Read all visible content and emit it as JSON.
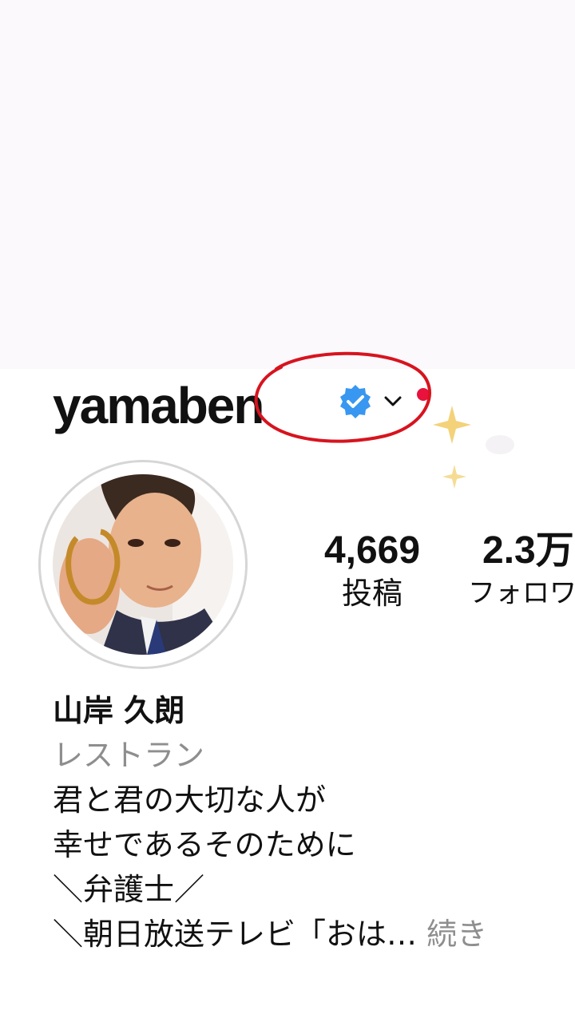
{
  "profile": {
    "username": "yamaben",
    "verified": true,
    "avatar_icon": "profile-photo"
  },
  "stats": [
    {
      "value": "4,669",
      "label": "投稿"
    },
    {
      "value": "2.3万",
      "label": "フォロワー"
    }
  ],
  "bio": {
    "name": "山岸 久朗",
    "category": "レストラン",
    "lines": [
      "君と君の大切な人が",
      "幸せであるそのために",
      "＼弁護士／"
    ],
    "truncated_line": "＼朝日放送テレビ「おは…",
    "more_label": "続き"
  },
  "colors": {
    "annotation_red": "#d7141f",
    "notification_dot": "#e8123c",
    "verified_blue": "#3897f0",
    "sparkle_gold": "#f3d27a"
  }
}
